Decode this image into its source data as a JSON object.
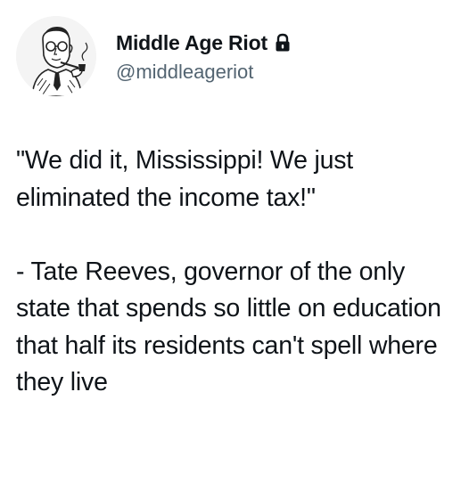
{
  "author": {
    "display_name": "Middle Age Riot",
    "handle": "@middleageriot",
    "protected_icon": "lock-icon",
    "avatar_icon": "man-with-pipe-illustration"
  },
  "tweet": {
    "paragraph_1": "\"We did it, Mississippi! We just eliminated the income tax!\"",
    "paragraph_2": "- Tate Reeves, governor of the only state that spends so little on education that half its residents can't spell where they live"
  }
}
